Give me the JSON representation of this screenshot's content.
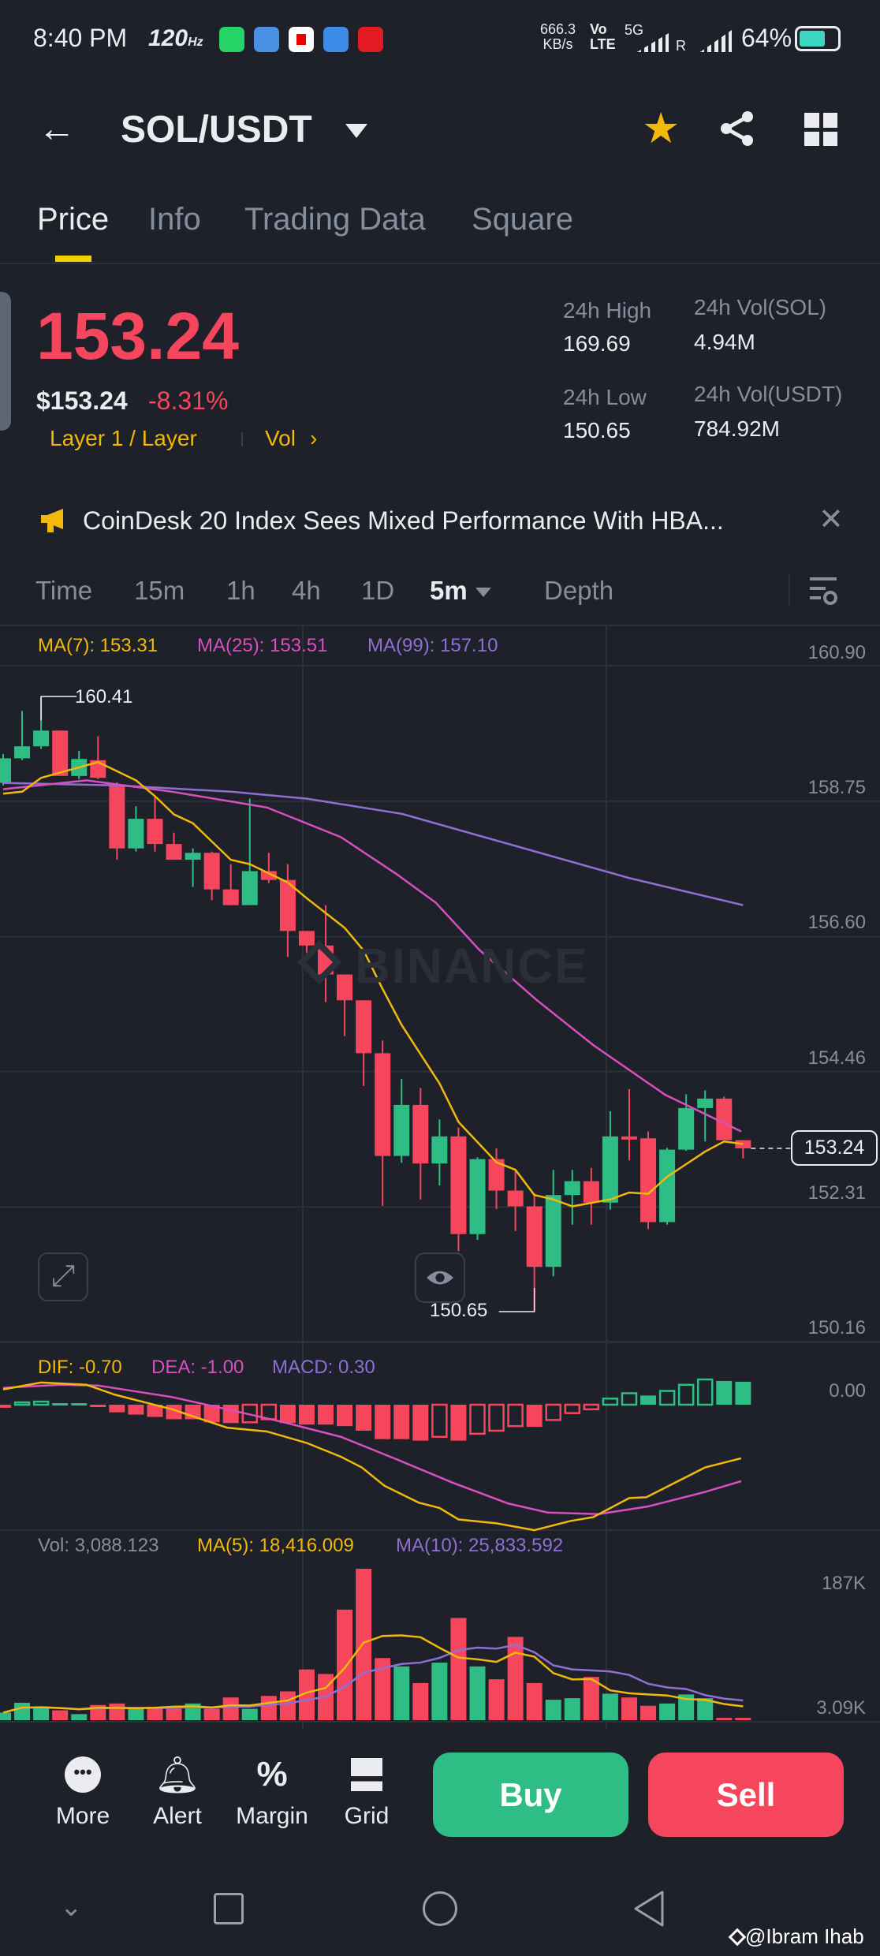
{
  "status_bar": {
    "time": "8:40 PM",
    "refresh": "120",
    "refresh_unit": "Hz",
    "net_speed": "666.3",
    "net_unit": "KB/s",
    "volte": "Vo LTE",
    "net_type": "5G",
    "roaming": "R",
    "battery": "64%"
  },
  "header": {
    "pair": "SOL/USDT"
  },
  "tabs": [
    {
      "label": "Price"
    },
    {
      "label": "Info"
    },
    {
      "label": "Trading Data"
    },
    {
      "label": "Square"
    }
  ],
  "price": {
    "last": "153.24",
    "usd": "$153.24",
    "change": "-8.31%",
    "category": "Layer 1 / Layer",
    "vol_link": "Vol",
    "stats": {
      "high_label": "24h High",
      "high": "169.69",
      "low_label": "24h Low",
      "low": "150.65",
      "vol_sol_label": "24h Vol(SOL)",
      "vol_sol": "4.94M",
      "vol_usdt_label": "24h Vol(USDT)",
      "vol_usdt": "784.92M"
    }
  },
  "news": {
    "headline": "CoinDesk 20 Index Sees Mixed Performance With HBA..."
  },
  "chart_tabs": [
    {
      "label": "Time"
    },
    {
      "label": "15m"
    },
    {
      "label": "1h"
    },
    {
      "label": "4h"
    },
    {
      "label": "1D"
    },
    {
      "label": "5m"
    },
    {
      "label": "Depth"
    }
  ],
  "legend": {
    "ma7": "MA(7): 153.31",
    "ma25": "MA(25): 153.51",
    "ma99": "MA(99): 157.10",
    "dif": "DIF: -0.70",
    "dea": "DEA: -1.00",
    "macd": "MACD: 0.30",
    "vol": "Vol: 3,088.123",
    "vma5": "MA(5): 18,416.009",
    "vma10": "MA(10): 25,833.592"
  },
  "watermark": "BINANCE",
  "colors": {
    "up": "#2ebd85",
    "down": "#f6465d",
    "ma7": "#f0b90b",
    "ma25": "#d84fc0",
    "ma99": "#8f6fd6",
    "accent": "#f0b90b"
  },
  "chart_data": {
    "type": "candlestick",
    "price_axis": [
      "160.90",
      "158.75",
      "156.60",
      "154.46",
      "152.31",
      "150.16"
    ],
    "price_ticks": [
      160.9,
      158.75,
      156.6,
      154.46,
      152.31,
      150.16
    ],
    "current_price": "153.24",
    "high_marker": "160.41",
    "low_marker": "150.65",
    "high_marker_value": 160.41,
    "low_marker_value": 150.65,
    "ohlc": [
      [
        159.04,
        159.5,
        159.0,
        159.43
      ],
      [
        159.43,
        160.18,
        159.4,
        159.62
      ],
      [
        159.62,
        160.41,
        159.58,
        159.87
      ],
      [
        159.87,
        159.87,
        159.15,
        159.15
      ],
      [
        159.15,
        159.55,
        159.1,
        159.42
      ],
      [
        159.4,
        159.78,
        159.1,
        159.12
      ],
      [
        159.0,
        159.05,
        157.82,
        158.0
      ],
      [
        158.0,
        158.67,
        157.95,
        158.47
      ],
      [
        158.47,
        158.83,
        157.95,
        158.07
      ],
      [
        158.07,
        158.25,
        157.82,
        157.82
      ],
      [
        157.82,
        158.0,
        157.39,
        157.93
      ],
      [
        157.93,
        157.95,
        157.18,
        157.35
      ],
      [
        157.35,
        157.75,
        157.1,
        157.1
      ],
      [
        157.1,
        158.79,
        157.1,
        157.64
      ],
      [
        157.64,
        157.93,
        157.45,
        157.5
      ],
      [
        157.5,
        157.75,
        156.28,
        156.69
      ],
      [
        156.69,
        156.69,
        156.24,
        156.46
      ],
      [
        156.46,
        157.1,
        155.56,
        156.0
      ],
      [
        156.0,
        156.0,
        155.02,
        155.59
      ],
      [
        155.59,
        155.59,
        154.23,
        154.75
      ],
      [
        154.75,
        154.95,
        152.33,
        153.12
      ],
      [
        153.12,
        154.34,
        153.01,
        153.93
      ],
      [
        153.93,
        154.2,
        152.43,
        153.0
      ],
      [
        153.0,
        153.7,
        152.65,
        153.43
      ],
      [
        153.43,
        153.57,
        151.61,
        151.88
      ],
      [
        151.88,
        153.1,
        151.79,
        153.07
      ],
      [
        153.07,
        153.24,
        152.28,
        152.57
      ],
      [
        152.57,
        152.9,
        151.93,
        152.32
      ],
      [
        152.32,
        152.53,
        150.65,
        151.36
      ],
      [
        151.36,
        152.9,
        151.21,
        152.5
      ],
      [
        152.5,
        152.9,
        152.03,
        152.72
      ],
      [
        152.72,
        152.93,
        152.03,
        152.38
      ],
      [
        152.38,
        153.83,
        152.27,
        153.43
      ],
      [
        153.43,
        154.18,
        153.05,
        153.38
      ],
      [
        153.4,
        153.51,
        151.96,
        152.07
      ],
      [
        152.07,
        153.25,
        152.03,
        153.22
      ],
      [
        153.22,
        154.1,
        153.2,
        153.88
      ],
      [
        153.88,
        154.16,
        153.35,
        154.03
      ],
      [
        154.03,
        154.06,
        153.37,
        153.37
      ],
      [
        153.37,
        153.37,
        153.08,
        153.24
      ]
    ],
    "ma7": [
      [
        0,
        158.87
      ],
      [
        1,
        158.9
      ],
      [
        2,
        159.12
      ],
      [
        5,
        159.37
      ],
      [
        7,
        159.08
      ],
      [
        8,
        158.83
      ],
      [
        9,
        158.54
      ],
      [
        10,
        158.4
      ],
      [
        12,
        157.82
      ],
      [
        13,
        157.75
      ],
      [
        15,
        157.46
      ],
      [
        16,
        157.21
      ],
      [
        18,
        156.74
      ],
      [
        19,
        156.38
      ],
      [
        20,
        155.77
      ],
      [
        21,
        155.2
      ],
      [
        23,
        154.27
      ],
      [
        24,
        153.66
      ],
      [
        26,
        153.02
      ],
      [
        27,
        152.9
      ],
      [
        28,
        152.5
      ],
      [
        29,
        152.43
      ],
      [
        30,
        152.32
      ],
      [
        32,
        152.43
      ],
      [
        33,
        152.54
      ],
      [
        34,
        152.52
      ],
      [
        35,
        152.79
      ],
      [
        37,
        153.19
      ],
      [
        38,
        153.35
      ],
      [
        39,
        153.31
      ]
    ],
    "ma25": [
      [
        0,
        158.94
      ],
      [
        4.4,
        159.08
      ],
      [
        8.9,
        158.9
      ],
      [
        13.9,
        158.65
      ],
      [
        17.8,
        158.18
      ],
      [
        20.7,
        157.6
      ],
      [
        22.8,
        157.14
      ],
      [
        25.1,
        156.39
      ],
      [
        28.1,
        155.6
      ],
      [
        31.1,
        154.88
      ],
      [
        34.9,
        154.09
      ],
      [
        38.9,
        153.51
      ]
    ],
    "ma99": [
      [
        0,
        159.04
      ],
      [
        6,
        159.0
      ],
      [
        12,
        158.9
      ],
      [
        16,
        158.79
      ],
      [
        21,
        158.55
      ],
      [
        27,
        158.04
      ],
      [
        33,
        157.53
      ],
      [
        39,
        157.1
      ]
    ],
    "macd_axis": "0.00",
    "dif": [
      [
        0,
        0.2
      ],
      [
        2,
        0.29
      ],
      [
        4.4,
        0.26
      ],
      [
        5.9,
        0.13
      ],
      [
        8.9,
        -0.06
      ],
      [
        11.8,
        -0.3
      ],
      [
        13.9,
        -0.35
      ],
      [
        16,
        -0.5
      ],
      [
        17.8,
        -0.68
      ],
      [
        18.9,
        -0.82
      ],
      [
        20.1,
        -1.06
      ],
      [
        21.9,
        -1.28
      ],
      [
        23,
        -1.35
      ],
      [
        24,
        -1.5
      ],
      [
        26,
        -1.55
      ],
      [
        28,
        -1.64
      ],
      [
        29.9,
        -1.52
      ],
      [
        31.1,
        -1.47
      ],
      [
        33,
        -1.22
      ],
      [
        33.9,
        -1.21
      ],
      [
        37,
        -0.82
      ],
      [
        38.9,
        -0.7
      ]
    ],
    "dea": [
      [
        0,
        0.22
      ],
      [
        3,
        0.26
      ],
      [
        5,
        0.25
      ],
      [
        8.9,
        0.1
      ],
      [
        11.8,
        -0.06
      ],
      [
        14.8,
        -0.23
      ],
      [
        17.8,
        -0.42
      ],
      [
        20.7,
        -0.71
      ],
      [
        23.7,
        -1.02
      ],
      [
        26.6,
        -1.29
      ],
      [
        28.7,
        -1.41
      ],
      [
        31.4,
        -1.43
      ],
      [
        34,
        -1.33
      ],
      [
        37,
        -1.14
      ],
      [
        38.9,
        -1.0
      ]
    ],
    "macd_hist": [
      -0.04,
      0.03,
      0.04,
      0.02,
      0.02,
      -0.03,
      -0.1,
      -0.13,
      -0.16,
      -0.19,
      -0.19,
      -0.23,
      -0.24,
      -0.23,
      -0.19,
      -0.24,
      -0.26,
      -0.26,
      -0.28,
      -0.34,
      -0.45,
      -0.45,
      -0.47,
      -0.42,
      -0.47,
      -0.38,
      -0.34,
      -0.28,
      -0.29,
      -0.2,
      -0.11,
      -0.06,
      0.08,
      0.15,
      0.12,
      0.18,
      0.26,
      0.33,
      0.31,
      0.3
    ],
    "volume_axis": [
      "187K",
      "3.09K"
    ],
    "volume_k": [
      10,
      23,
      18,
      13,
      8,
      20,
      22,
      16,
      16,
      15,
      22,
      15,
      30,
      15,
      32,
      38,
      67,
      61,
      146,
      200,
      82,
      71,
      49,
      76,
      135,
      71,
      54,
      110,
      49,
      27,
      29,
      57,
      35,
      30,
      19,
      22,
      34,
      29,
      3,
      3
    ]
  },
  "toolbar": {
    "more": "More",
    "alert": "Alert",
    "margin": "Margin",
    "grid": "Grid",
    "buy": "Buy",
    "sell": "Sell"
  },
  "credit": "@Ibram Ihab"
}
